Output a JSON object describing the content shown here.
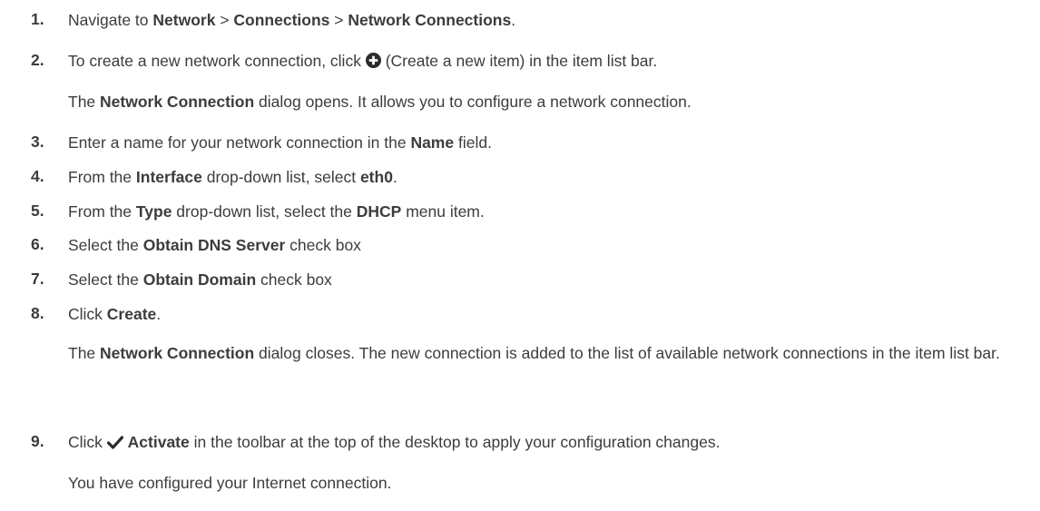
{
  "steps": [
    {
      "number": "1.",
      "parts": [
        "Navigate to ",
        "Network",
        " > ",
        "Connections",
        " > ",
        "Network Connections",
        "."
      ]
    },
    {
      "number": "2.",
      "parts": [
        "To create a new network connection, click ",
        "(Create a new item) in the item list bar."
      ],
      "icon": "plus-circle-icon",
      "note_parts": [
        "The ",
        "Network Connection",
        " dialog opens. It allows you to configure a network connection."
      ]
    },
    {
      "number": "3.",
      "parts": [
        "Enter a name for your network connection in the ",
        "Name",
        " field."
      ]
    },
    {
      "number": "4.",
      "parts": [
        "From the ",
        "Interface",
        " drop-down list, select ",
        "eth0",
        "."
      ]
    },
    {
      "number": "5.",
      "parts": [
        "From the ",
        "Type",
        " drop-down list, select the ",
        "DHCP",
        " menu item."
      ]
    },
    {
      "number": "6.",
      "parts": [
        "Select the ",
        "Obtain DNS Server",
        " check box"
      ]
    },
    {
      "number": "7.",
      "parts": [
        "Select the ",
        "Obtain Domain",
        " check box"
      ]
    },
    {
      "number": "8.",
      "parts": [
        "Click ",
        "Create",
        "."
      ],
      "note_parts": [
        "The ",
        "Network Connection",
        " dialog closes. The new connection is added to the list of available network connections in the item list bar."
      ]
    },
    {
      "number": "9.",
      "parts": [
        "Click ",
        "Activate",
        " in the toolbar at the top of the desktop to apply your configuration changes."
      ],
      "icon": "checkmark-icon",
      "note": "You have configured your Internet connection."
    }
  ]
}
